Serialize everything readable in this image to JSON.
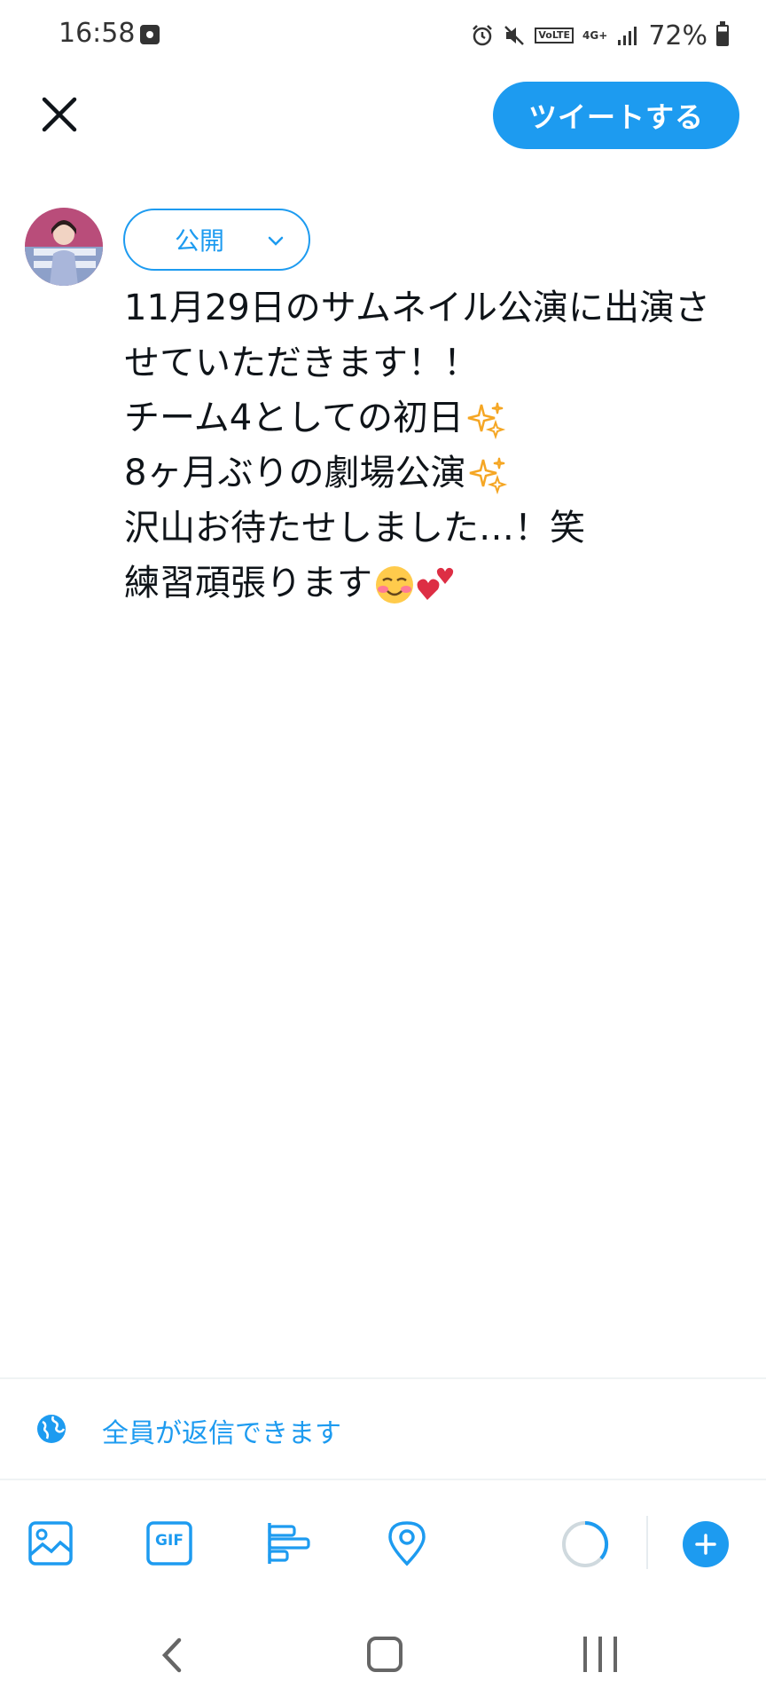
{
  "status_bar": {
    "time": "16:58",
    "battery": "72%",
    "icons": [
      "notification-icon",
      "alarm-icon",
      "mute-icon",
      "volte-icon",
      "4g-icon",
      "signal-icon",
      "battery-icon"
    ],
    "volte_label": "VoLTE",
    "network_label": "4G+"
  },
  "header": {
    "close_icon": "close-icon",
    "tweet_button_label": "ツイートする",
    "accent_color": "#1d9bf0"
  },
  "composer": {
    "audience_label": "公開",
    "tweet_lines": [
      "11月29日のサムネイル公演に出演さ",
      "せていただきます！！",
      "チーム4としての初日",
      "8ヶ月ぶりの劇場公演",
      "沢山お待たせしました…！笑",
      "練習頑張ります"
    ],
    "emojis": {
      "line3": "sparkles-icon",
      "line4": "sparkles-icon",
      "line6": [
        "smiling-face-icon",
        "two-hearts-icon"
      ]
    }
  },
  "reply_setting": {
    "label": "全員が返信できます",
    "icon": "globe-icon"
  },
  "toolbar": {
    "items": [
      "image-icon",
      "gif-icon",
      "poll-icon",
      "location-icon"
    ],
    "gif_label": "GIF",
    "progress_icon": "character-count-ring",
    "add_icon": "plus-icon"
  },
  "navbar": {
    "items": [
      "back-icon",
      "home-icon",
      "recent-apps-icon"
    ]
  }
}
